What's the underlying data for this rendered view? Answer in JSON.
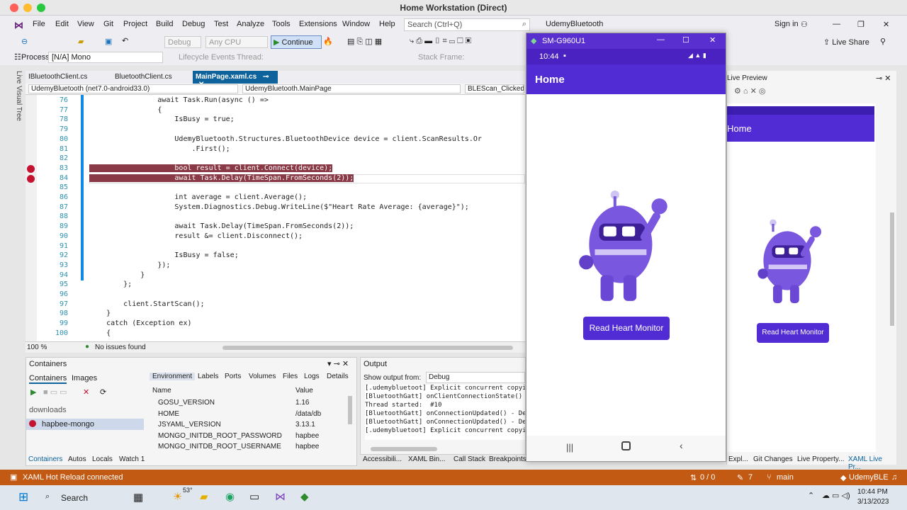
{
  "window_title": "Home Workstation (Direct)",
  "menu": [
    "File",
    "Edit",
    "View",
    "Git",
    "Project",
    "Build",
    "Debug",
    "Test",
    "Analyze",
    "Tools",
    "Extensions",
    "Window",
    "Help"
  ],
  "search_placeholder": "Search (Ctrl+Q)",
  "solution": "UdemyBluetooth",
  "sign_in": "Sign in",
  "toolbar": {
    "config": "Debug",
    "platform": "Any CPU",
    "continue": "Continue",
    "live_share": "Live Share",
    "lifecycle": "Lifecycle Events",
    "thread": "Thread:",
    "stack": "Stack Frame:"
  },
  "process": {
    "label": "Process:",
    "value": "[N/A] Mono"
  },
  "left_rail": "Live Visual Tree",
  "tabs": [
    "IBluetoothClient.cs",
    "BluetoothClient.cs",
    "MainPage.xaml.cs"
  ],
  "nav": {
    "project": "UdemyBluetooth (net7.0-android33.0)",
    "class": "UdemyBluetooth.MainPage",
    "member": "BLEScan_Clicked"
  },
  "code_lines": [
    {
      "n": "76",
      "t": "                await Task.Run(async () =>"
    },
    {
      "n": "77",
      "t": "                {"
    },
    {
      "n": "78",
      "t": "                    IsBusy = true;"
    },
    {
      "n": "79",
      "t": ""
    },
    {
      "n": "80",
      "t": "                    UdemyBluetooth.Structures.BluetoothDevice device = client.ScanResults.Or"
    },
    {
      "n": "81",
      "t": "                        .First();"
    },
    {
      "n": "82",
      "t": ""
    },
    {
      "n": "83",
      "t": "                    bool result = client.Connect(device);"
    },
    {
      "n": "84",
      "t": "                    await Task.Delay(TimeSpan.FromSeconds(2));"
    },
    {
      "n": "85",
      "t": ""
    },
    {
      "n": "86",
      "t": "                    int average = client.Average();"
    },
    {
      "n": "87",
      "t": "                    System.Diagnostics.Debug.WriteLine($\"Heart Rate Average: {average}\");"
    },
    {
      "n": "88",
      "t": ""
    },
    {
      "n": "89",
      "t": "                    await Task.Delay(TimeSpan.FromSeconds(2));"
    },
    {
      "n": "90",
      "t": "                    result &= client.Disconnect();"
    },
    {
      "n": "91",
      "t": ""
    },
    {
      "n": "92",
      "t": "                    IsBusy = false;"
    },
    {
      "n": "93",
      "t": "                });"
    },
    {
      "n": "94",
      "t": "            }"
    },
    {
      "n": "95",
      "t": "        };"
    },
    {
      "n": "96",
      "t": ""
    },
    {
      "n": "97",
      "t": "        client.StartScan();"
    },
    {
      "n": "98",
      "t": "    }"
    },
    {
      "n": "99",
      "t": "    catch (Exception ex)"
    },
    {
      "n": "100",
      "t": "    {"
    }
  ],
  "editor_status": {
    "zoom": "100 %",
    "issues": "No issues found"
  },
  "containers": {
    "title": "Containers",
    "tabs": [
      "Containers",
      "Images"
    ],
    "group": "downloads",
    "item": "hapbee-mongo",
    "env_tabs": [
      "Environment",
      "Labels",
      "Ports",
      "Volumes",
      "Files",
      "Logs",
      "Details"
    ],
    "col_name": "Name",
    "col_value": "Value",
    "rows": [
      [
        "GOSU_VERSION",
        "1.16"
      ],
      [
        "HOME",
        "/data/db"
      ],
      [
        "JSYAML_VERSION",
        "3.13.1"
      ],
      [
        "MONGO_INITDB_ROOT_PASSWORD",
        "hapbee"
      ],
      [
        "MONGO_INITDB_ROOT_USERNAME",
        "hapbee"
      ]
    ]
  },
  "output": {
    "title": "Output",
    "show_from": "Show output from:",
    "source": "Debug",
    "lines": [
      "[.udemybluetoot] Explicit concurrent copyin",
      "[BluetoothGatt] onClientConnectionState() -",
      "Thread started:  #10",
      "[BluetoothGatt] onConnectionUpdated() - Dev",
      "[BluetoothGatt] onConnectionUpdated() - Dev",
      "[.udemybluetoot] Explicit concurrent copyin"
    ]
  },
  "bottom_tabs_left": [
    "Containers",
    "Autos",
    "Locals",
    "Watch 1"
  ],
  "bottom_tabs_right": [
    "Accessibili...",
    "XAML Bin...",
    "Call Stack",
    "Breakpoints"
  ],
  "bottom_tabs_far": [
    "Expl...",
    "Git Changes",
    "Live Property...",
    "XAML Live Pr..."
  ],
  "phone": {
    "title": "SM-G960U1",
    "time": "10:44",
    "page": "Home",
    "button": "Read Heart Monitor"
  },
  "preview": {
    "title": "Live Preview",
    "page": "Home",
    "button": "Read Heart Monitor"
  },
  "status": {
    "hot_reload": "XAML Hot Reload connected",
    "errors": "0 / 0",
    "edits": "7",
    "branch": "main",
    "repo": "UdemyBLE"
  },
  "taskbar": {
    "search": "Search",
    "temp": "53°",
    "time": "10:44 PM",
    "date": "3/13/2023"
  },
  "colors": {
    "accent": "#512bd4",
    "status": "#c35a14",
    "breakpoint": "#c5122f"
  }
}
